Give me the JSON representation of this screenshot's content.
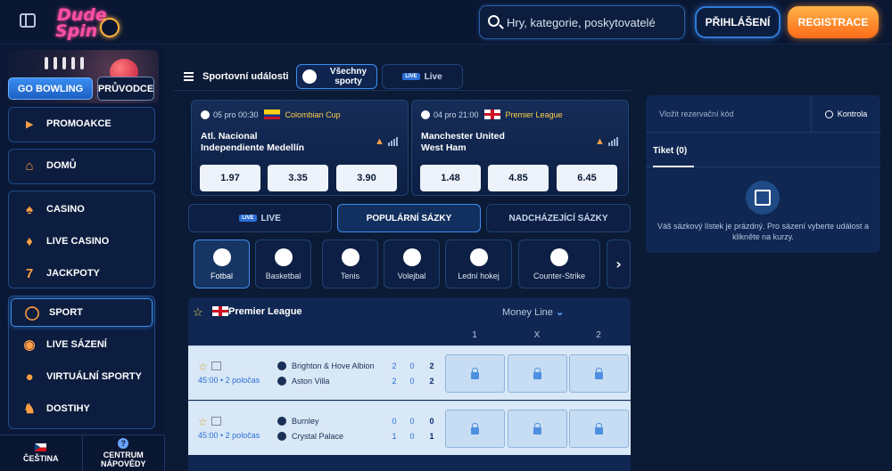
{
  "header": {
    "logo_line1": "Dude",
    "logo_line2": "Spin",
    "search_placeholder": "Hry, kategorie, poskytovatelé",
    "login": "PŘIHLÁŠENÍ",
    "register": "REGISTRACE"
  },
  "sidebar": {
    "go_bowling": "GO BOWLING",
    "guide": "PRŮVODCE",
    "items": [
      {
        "label": "PROMOAKCE",
        "icon": "megaphone-icon"
      },
      {
        "label": "DOMŮ",
        "icon": "home-icon"
      },
      {
        "label": "CASINO",
        "icon": "spade-icon"
      },
      {
        "label": "LIVE CASINO",
        "icon": "cards-icon"
      },
      {
        "label": "JACKPOTY",
        "icon": "777-icon"
      },
      {
        "label": "SPORT",
        "icon": "volleyball-icon"
      },
      {
        "label": "LIVE SÁZENÍ",
        "icon": "live-icon"
      },
      {
        "label": "VIRTUÁLNÍ SPORTY",
        "icon": "gamepad-icon"
      },
      {
        "label": "DOSTIHY",
        "icon": "horse-icon"
      }
    ],
    "footer_language": "ČEŠTINA",
    "footer_help": "CENTRUM NÁPOVĚDY"
  },
  "sports_header": {
    "title": "Sportovní události",
    "tab_all": "Všechny sporty",
    "tab_live": "Live",
    "live_badge": "LIVE"
  },
  "featured": [
    {
      "time": "05 pro 00:30",
      "league": "Colombian Cup",
      "home": "Atl. Nacional",
      "away": "Independiente Medellín",
      "odds": [
        "1.97",
        "3.35",
        "3.90"
      ]
    },
    {
      "time": "04 pro 21:00",
      "league": "Premier League",
      "home": "Manchester United",
      "away": "West Ham",
      "odds": [
        "1.48",
        "4.85",
        "6.45"
      ]
    }
  ],
  "mode_tabs": {
    "live": "LIVE",
    "popular": "POPULÁRNÍ SÁZKY",
    "upcoming": "NADCHÁZEJÍCÍ SÁZKY"
  },
  "sports": [
    "Fotbal",
    "Basketbal",
    "Tenis",
    "Volejbal",
    "Lední hokej",
    "Counter-Strike"
  ],
  "league": {
    "name": "Premier League",
    "market": "Money Line",
    "cols": [
      "1",
      "X",
      "2"
    ],
    "events": [
      {
        "time": "45:00 • 2 poločas",
        "home": "Brighton & Hove Albion",
        "away": "Aston Villa",
        "home_scores": [
          "2",
          "0",
          "2"
        ],
        "away_scores": [
          "2",
          "0",
          "2"
        ]
      },
      {
        "time": "45:00 • 2 poločas",
        "home": "Burnley",
        "away": "Crystal Palace",
        "home_scores": [
          "0",
          "0",
          "0"
        ],
        "away_scores": [
          "1",
          "0",
          "1"
        ]
      }
    ]
  },
  "betslip": {
    "code_placeholder": "Vložit rezervační kód",
    "check": "Kontrola",
    "tab": "Tiket (0)",
    "empty_text": "Váš sázkový lístek je prázdný. Pro sázení vyberte událost a klikněte na kurzy."
  }
}
